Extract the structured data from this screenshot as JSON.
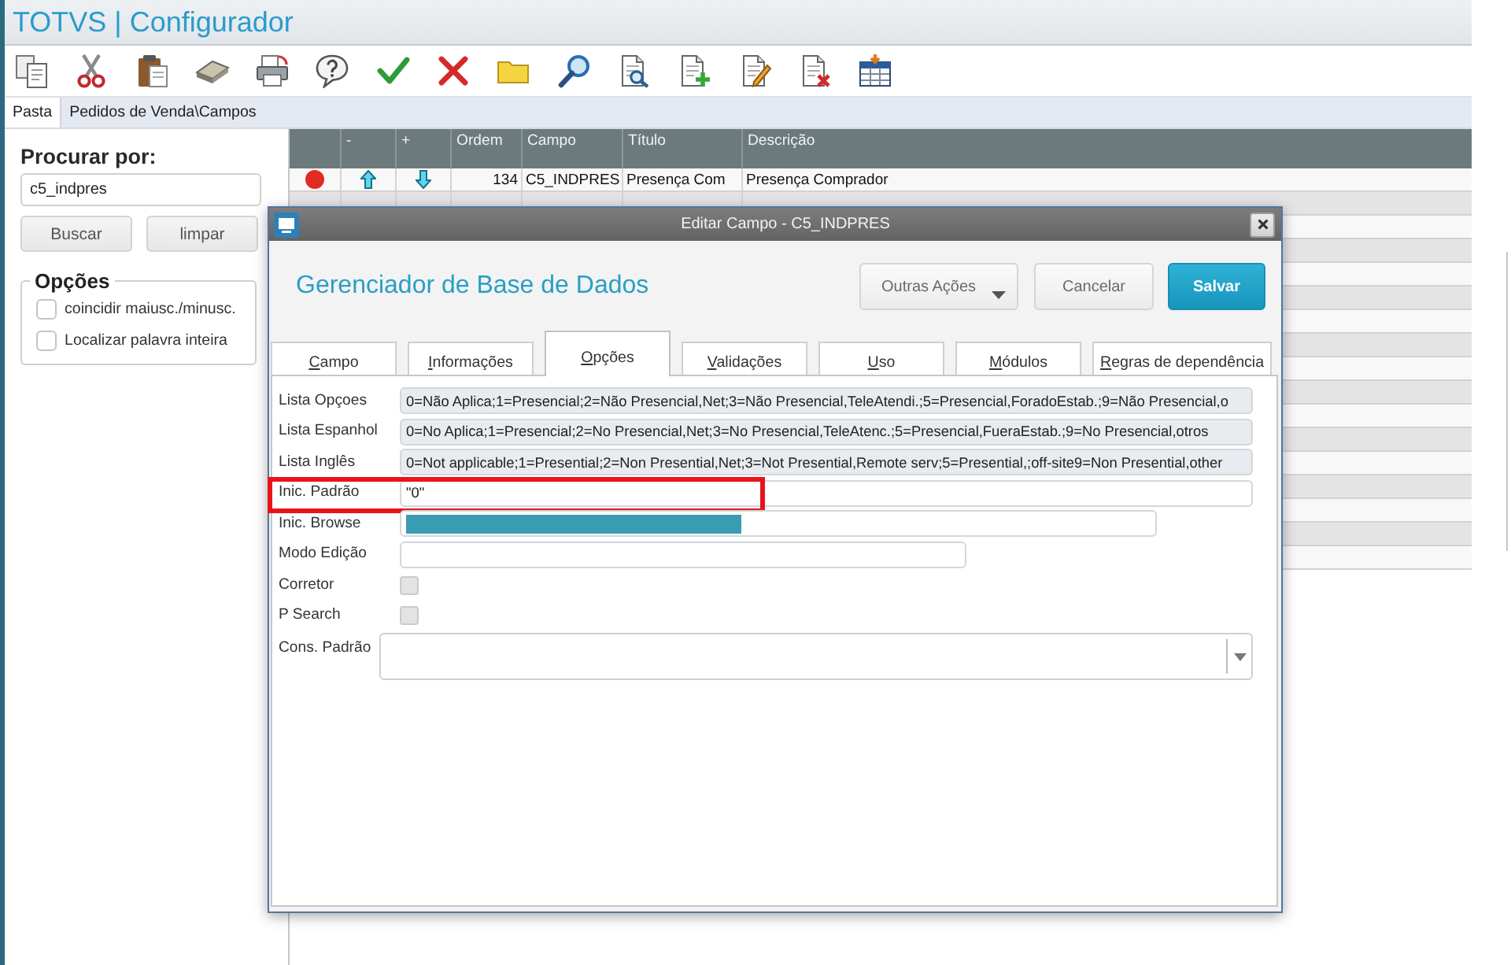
{
  "window": {
    "title": "TOTVS | Configurador"
  },
  "folder_tabs": [
    {
      "label": "Pasta",
      "selected": true
    }
  ],
  "breadcrumb": "Pedidos de Venda\\Campos",
  "search_panel": {
    "label": "Procurar por:",
    "query": "c5_indpres",
    "buttons": [
      "Buscar",
      "limpar"
    ],
    "options_title": "Opções",
    "options": [
      {
        "label": "coincidir maiusc./minusc.",
        "checked": false
      },
      {
        "label": "Localizar palavra inteira",
        "checked": false
      }
    ]
  },
  "grid": {
    "columns": [
      "-",
      "+",
      "Ordem",
      "Campo",
      "Título",
      "Descrição"
    ],
    "rows": [
      {
        "color": "#e02a22",
        "ordem": "134",
        "campo": "C5_INDPRES",
        "titulo": "Presença Com",
        "descricao": "Presença Comprador"
      }
    ]
  },
  "dialog": {
    "title": "Editar Campo - C5_INDPRES",
    "heading": "Gerenciador de Base de Dados",
    "actions": [
      {
        "label": "Outras Ações",
        "kind": "menu"
      },
      {
        "label": "Cancelar",
        "kind": "secondary"
      },
      {
        "label": "Salvar",
        "kind": "primary"
      }
    ],
    "tabs": [
      {
        "label": "Campo",
        "selected": false
      },
      {
        "label": "Informações",
        "selected": false
      },
      {
        "label": "Opções",
        "selected": true
      },
      {
        "label": "Validações",
        "selected": false
      },
      {
        "label": "Uso",
        "selected": false
      },
      {
        "label": "Módulos",
        "selected": false
      },
      {
        "label": "Regras de dependência",
        "selected": false
      }
    ],
    "fields": [
      {
        "label": "Lista Opçoes",
        "kind": "readonly",
        "value": "0=Não Aplica;1=Presencial;2=Não Presencial,Net;3=Não Presencial,TeleAtendi.;5=Presencial,ForadoEstab.;9=Não Presencial,o",
        "highlighted": false
      },
      {
        "label": "Lista Espanhol",
        "kind": "readonly",
        "value": "0=No Aplica;1=Presencial;2=No Presencial,Net;3=No Presencial,TeleAtenc.;5=Presencial,FueraEstab.;9=No Presencial,otros",
        "highlighted": false
      },
      {
        "label": "Lista Inglês",
        "kind": "readonly",
        "value": "0=Not applicable;1=Presential;2=Non Presential,Net;3=Not Presential,Remote serv;5=Presential,;off-site9=Non Presential,other",
        "highlighted": false
      },
      {
        "label": "Inic. Padrão",
        "kind": "text",
        "value": "\"0\"",
        "highlighted": true,
        "text_selected": false
      },
      {
        "label": "Inic. Browse",
        "kind": "text",
        "highlighted": false,
        "text_selected": true
      },
      {
        "label": "Modo Edição",
        "kind": "text",
        "highlighted": false,
        "text_selected": false
      },
      {
        "label": "Corretor",
        "kind": "checkbox",
        "checked": false,
        "disabled": true,
        "highlighted": false
      },
      {
        "label": "P Search",
        "kind": "checkbox",
        "checked": false,
        "disabled": true,
        "highlighted": false
      },
      {
        "label": "Cons. Padrão",
        "kind": "combo",
        "highlighted": false
      }
    ]
  }
}
